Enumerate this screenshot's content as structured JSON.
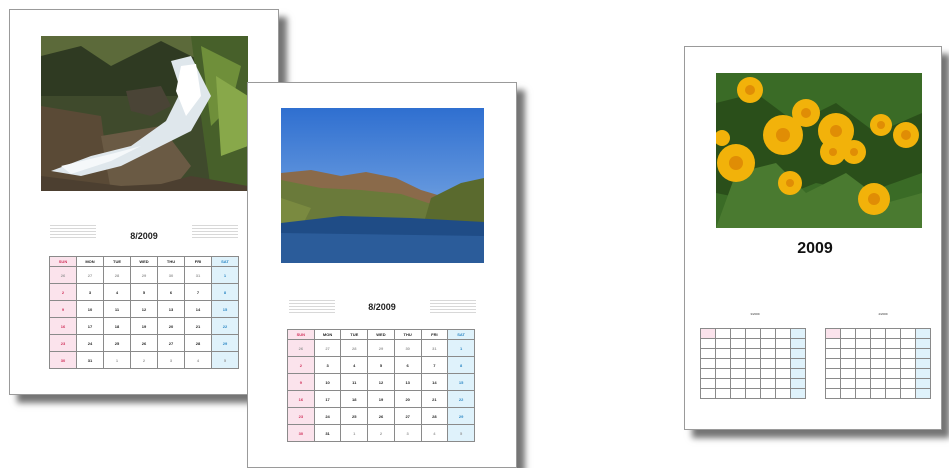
{
  "calendar_a": {
    "month_title": "8/2009",
    "days": [
      "SUN",
      "MON",
      "TUE",
      "WED",
      "THU",
      "FRI",
      "SAT"
    ],
    "rows": [
      [
        "26",
        "27",
        "28",
        "29",
        "30",
        "31",
        "1"
      ],
      [
        "2",
        "3",
        "4",
        "5",
        "6",
        "7",
        "8"
      ],
      [
        "9",
        "10",
        "11",
        "12",
        "13",
        "14",
        "15"
      ],
      [
        "16",
        "17",
        "18",
        "19",
        "20",
        "21",
        "22"
      ],
      [
        "23",
        "24",
        "25",
        "26",
        "27",
        "28",
        "29"
      ],
      [
        "30",
        "31",
        "1",
        "2",
        "3",
        "4",
        "5"
      ]
    ]
  },
  "calendar_b": {
    "month_title": "8/2009",
    "days": [
      "SUN",
      "MON",
      "TUE",
      "WED",
      "THU",
      "FRI",
      "SAT"
    ],
    "rows": [
      [
        "26",
        "27",
        "28",
        "29",
        "30",
        "31",
        "1"
      ],
      [
        "2",
        "3",
        "4",
        "5",
        "6",
        "7",
        "8"
      ],
      [
        "9",
        "10",
        "11",
        "12",
        "13",
        "14",
        "15"
      ],
      [
        "16",
        "17",
        "18",
        "19",
        "20",
        "21",
        "22"
      ],
      [
        "23",
        "24",
        "25",
        "26",
        "27",
        "28",
        "29"
      ],
      [
        "30",
        "31",
        "1",
        "2",
        "3",
        "4",
        "5"
      ]
    ]
  },
  "calendar_c": {
    "year_title": "2009",
    "left_label": "3/2009",
    "right_label": "4/2009"
  },
  "colors": {
    "sunday": "#d0305a",
    "saturday": "#2a86c4",
    "sunday_bg": "#fbe3ec",
    "saturday_bg": "#dff2fb"
  }
}
